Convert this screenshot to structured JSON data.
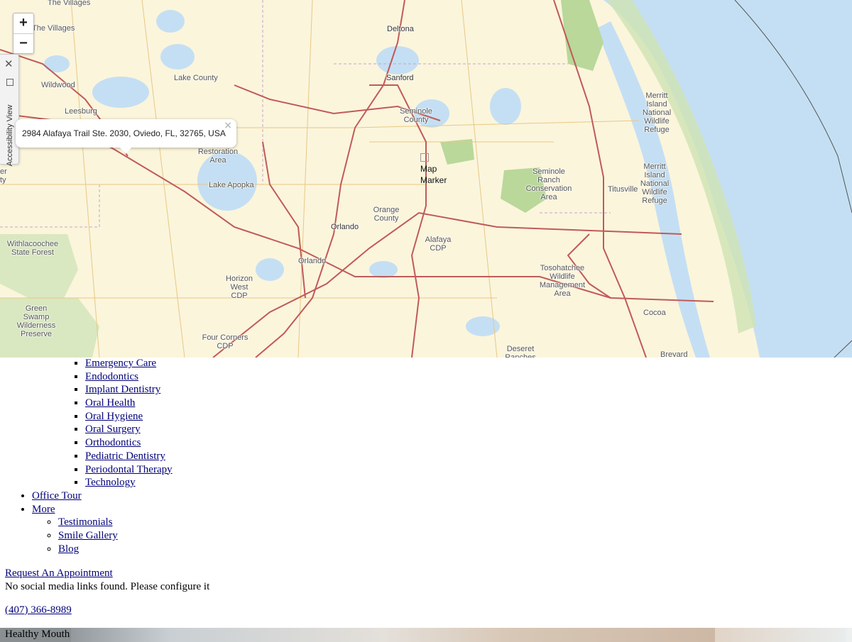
{
  "map": {
    "zoom_in": "+",
    "zoom_out": "−",
    "accessibility": {
      "close": "✕",
      "label": "Accessibility View"
    },
    "popup": {
      "address": "2984 Alafaya Trail Ste. 2030, Oviedo, FL, 32765, USA",
      "close": "×"
    },
    "marker": "Map Marker",
    "places": {
      "villages_top": "The Villages",
      "villages": "The Villages",
      "deltona": "Deltona",
      "lake_county": "Lake County",
      "wildwood": "Wildwood",
      "sanford": "Sanford",
      "leesburg": "Leesburg",
      "seminole_county": "Seminole County",
      "merritt1": "Merritt Island National Wildlife Refuge",
      "restoration": "Restoration Area",
      "merritt2": "Merritt Island National Wildlife Refuge",
      "seminole_ranch": "Seminole Ranch Conservation Area",
      "titusville": "Titusville",
      "lake_apopka": "Lake Apopka",
      "orange_county": "Orange County",
      "orlando": "Orlando",
      "alafaya": "Alafaya CDP",
      "withlacoochee": "Withlacoochee State Forest",
      "orlando2": "Orlando",
      "tosohatchee": "Tosohatchee Wildlife Management Area",
      "horizon": "Horizon West CDP",
      "green_swamp": "Green Swamp Wilderness Preserve",
      "cocoa": "Cocoa",
      "four_corners": "Four Corners CDP",
      "deseret": "Deseret Ranches",
      "brevard": "Brevard",
      "edge1": "er",
      "edge2": "ty"
    },
    "colors": {
      "land": "#fbf5dc",
      "water": "#c4dff3",
      "park": "#cfe3b3",
      "road": "#c05a5a",
      "minor_road": "#e8c884"
    }
  },
  "services_list": [
    "Emergency Care",
    "Endodontics",
    "Implant Dentistry",
    "Oral Health",
    "Oral Hygiene",
    "Oral Surgery",
    "Orthodontics",
    "Pediatric Dentistry",
    "Periodontal Therapy",
    "Technology"
  ],
  "nav": {
    "office_tour": "Office Tour",
    "more": "More",
    "more_items": [
      "Testimonials",
      "Smile Gallery",
      "Blog"
    ]
  },
  "cta": {
    "request": "Request An Appointment"
  },
  "social_notice": "No social media links found. Please configure it",
  "phone": "(407) 366-8989",
  "hero": {
    "title": "Healthy Mouth"
  }
}
